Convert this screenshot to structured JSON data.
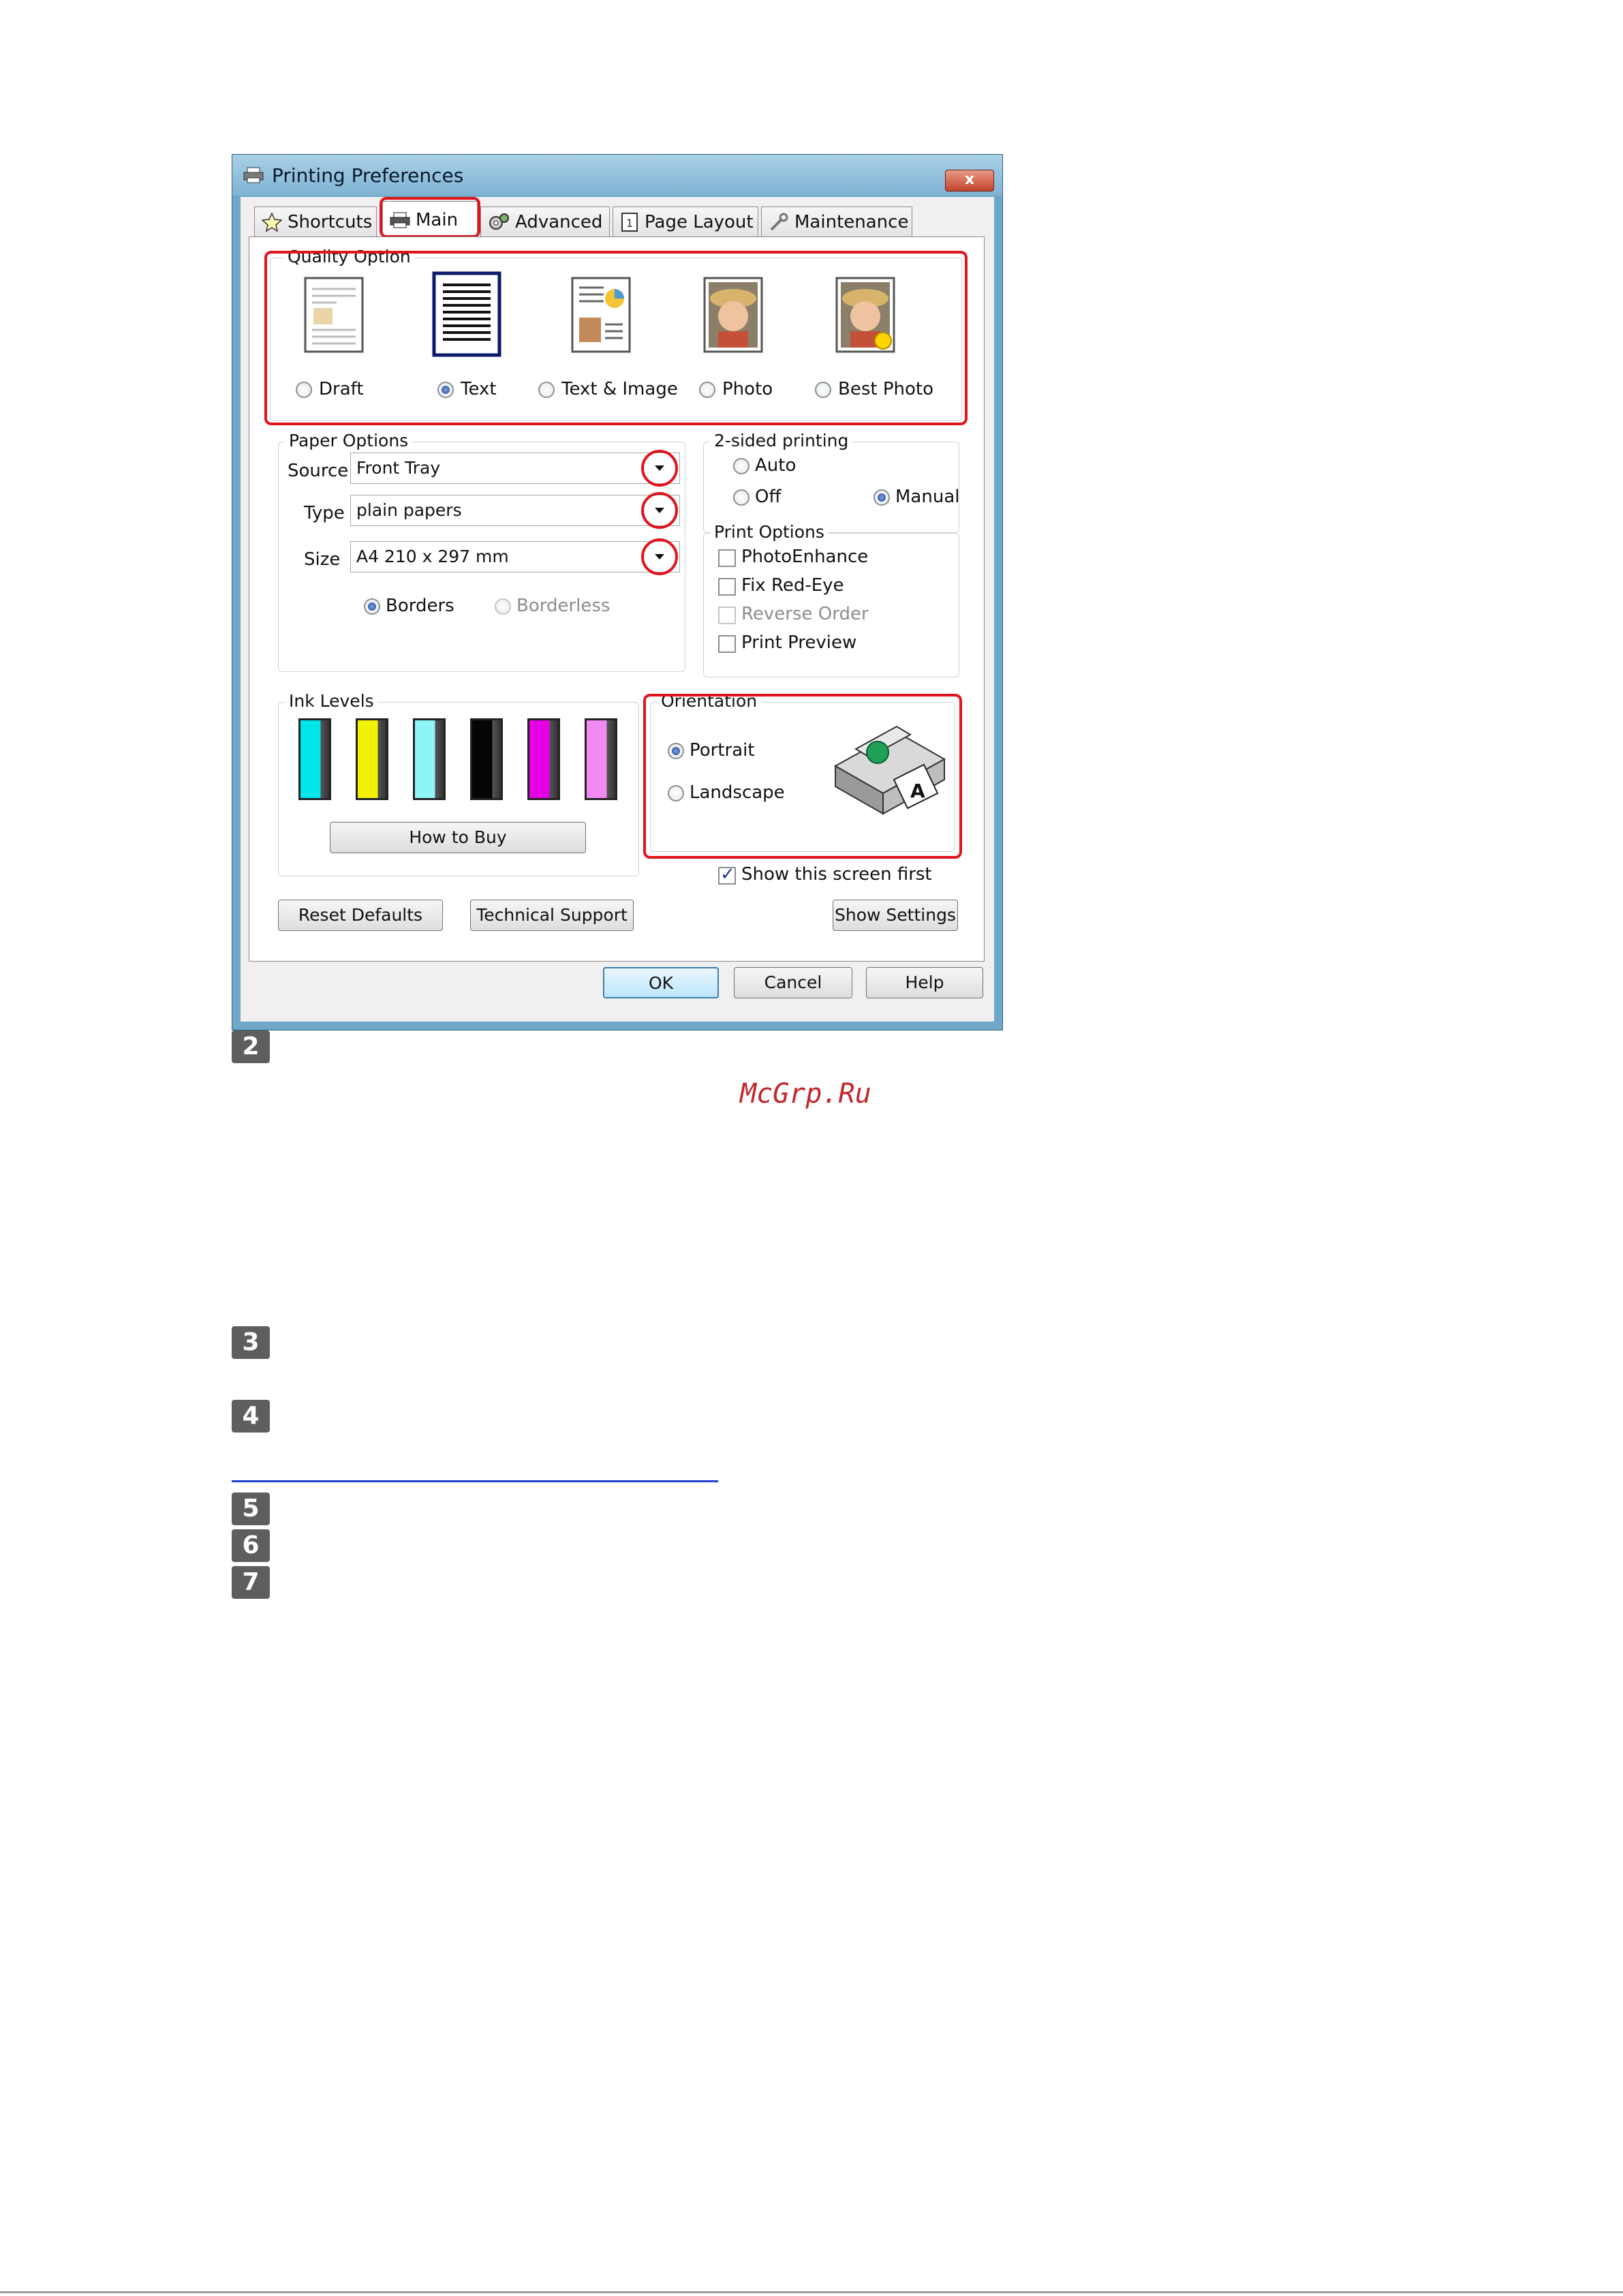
{
  "window": {
    "title": "Printing Preferences",
    "close_label": "x"
  },
  "tabs": [
    {
      "label": "Shortcuts"
    },
    {
      "label": "Main"
    },
    {
      "label": "Advanced"
    },
    {
      "label": "Page Layout"
    },
    {
      "label": "Maintenance"
    }
  ],
  "quality": {
    "title": "Quality Option",
    "options": [
      {
        "label": "Draft",
        "selected": false
      },
      {
        "label": "Text",
        "selected": true
      },
      {
        "label": "Text & Image",
        "selected": false
      },
      {
        "label": "Photo",
        "selected": false
      },
      {
        "label": "Best Photo",
        "selected": false
      }
    ]
  },
  "paper": {
    "title": "Paper Options",
    "source_label": "Source",
    "source_value": "Front Tray",
    "type_label": "Type",
    "type_value": "plain papers",
    "size_label": "Size",
    "size_value": "A4 210 x 297 mm",
    "borders_label": "Borders",
    "borderless_label": "Borderless"
  },
  "two_sided": {
    "title": "2-sided printing",
    "auto": "Auto",
    "off": "Off",
    "manual": "Manual"
  },
  "print_options": {
    "title": "Print Options",
    "items": [
      {
        "label": "PhotoEnhance",
        "checked": false,
        "enabled": true
      },
      {
        "label": "Fix Red-Eye",
        "checked": false,
        "enabled": true
      },
      {
        "label": "Reverse Order",
        "checked": false,
        "enabled": false
      },
      {
        "label": "Print Preview",
        "checked": false,
        "enabled": true
      }
    ]
  },
  "ink": {
    "title": "Ink Levels",
    "colors": [
      "#00e5ea",
      "#f2f200",
      "#8ff4f8",
      "#050505",
      "#e600e6",
      "#f38af3"
    ],
    "how_to_buy": "How to Buy"
  },
  "orientation": {
    "title": "Orientation",
    "portrait": "Portrait",
    "landscape": "Landscape"
  },
  "show_first": "Show this screen first",
  "buttons": {
    "reset": "Reset Defaults",
    "support": "Technical Support",
    "show_settings": "Show Settings",
    "ok": "OK",
    "cancel": "Cancel",
    "help": "Help"
  },
  "watermark": "McGrp.Ru",
  "steps": [
    "2",
    "3",
    "4",
    "5",
    "6",
    "7"
  ],
  "colors": {
    "highlight": "#e1141e",
    "link": "#1f3fd1",
    "watermark": "#c2282e"
  }
}
